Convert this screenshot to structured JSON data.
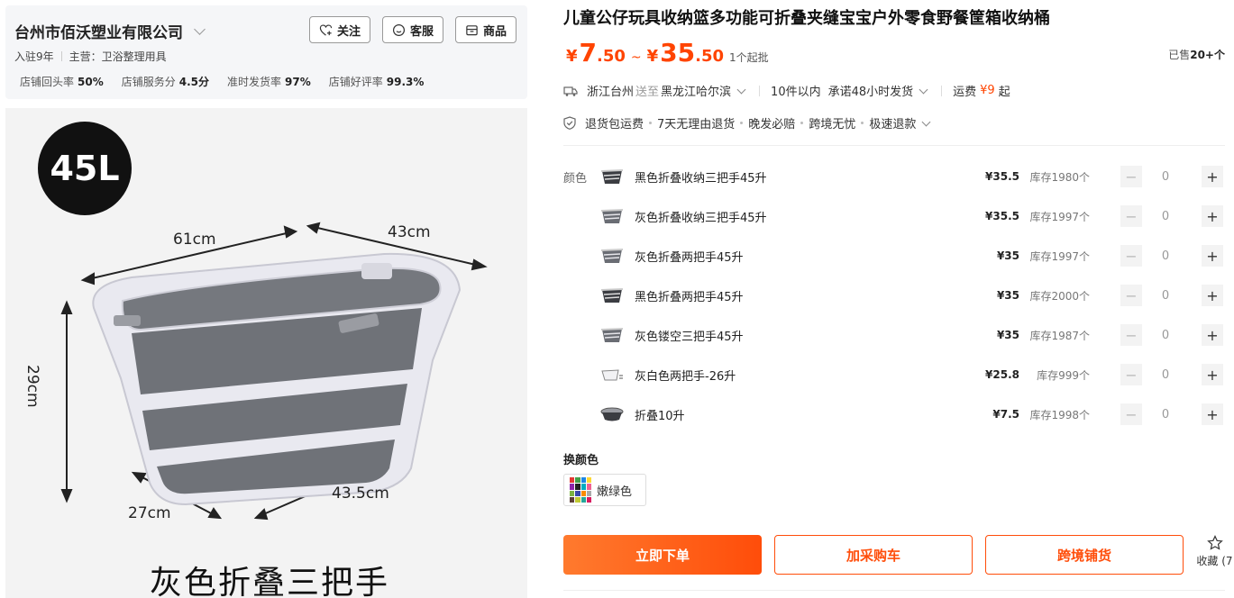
{
  "shop": {
    "name": "台州市佰沃塑业有限公司",
    "years": "入驻9年",
    "main_business": "主营：卫浴整理用具",
    "stats": [
      {
        "label": "店铺回头率",
        "value": "50%"
      },
      {
        "label": "店铺服务分",
        "value": "4.5分"
      },
      {
        "label": "准时发货率",
        "value": "97%"
      },
      {
        "label": "店铺好评率",
        "value": "99.3%"
      }
    ],
    "buttons": {
      "follow": "关注",
      "service": "客服",
      "goods": "商品"
    }
  },
  "image": {
    "badge": "45L",
    "dim_top_left": "61cm",
    "dim_top_right": "43cm",
    "dim_height": "29cm",
    "dim_bottom_left": "27cm",
    "dim_bottom_right": "43.5cm",
    "caption": "灰色折叠三把手"
  },
  "product": {
    "title": "儿童公仔玩具收纳篮多功能可折叠夹缝宝宝户外零食野餐筐箱收纳桶",
    "price_low_int": "7",
    "price_low_dec": ".50",
    "price_high_int": "35",
    "price_high_dec": ".50",
    "currency": "¥",
    "moq": "1个起批",
    "sold_prefix": "已售",
    "sold_value": "20+个"
  },
  "shipping": {
    "from": "浙江台州",
    "to_word": "送至",
    "to": "黑龙江哈尔滨",
    "qty_rule": "10件以内",
    "promise": "承诺48小时发货",
    "fee_label": "运费",
    "fee_value": "¥9",
    "fee_suffix": "起"
  },
  "services": [
    "退货包运费",
    "7天无理由退货",
    "晚发必赔",
    "跨境无忧",
    "极速退款"
  ],
  "sku": {
    "label": "颜色",
    "items": [
      {
        "name": "黑色折叠收纳三把手45升",
        "price": "¥35.5",
        "stock": "库存1980个",
        "qty": "0"
      },
      {
        "name": "灰色折叠收纳三把手45升",
        "price": "¥35.5",
        "stock": "库存1997个",
        "qty": "0"
      },
      {
        "name": "灰色折叠两把手45升",
        "price": "¥35",
        "stock": "库存1997个",
        "qty": "0"
      },
      {
        "name": "黑色折叠两把手45升",
        "price": "¥35",
        "stock": "库存2000个",
        "qty": "0"
      },
      {
        "name": "灰色镂空三把手45升",
        "price": "¥35",
        "stock": "库存1987个",
        "qty": "0"
      },
      {
        "name": "灰白色两把手-26升",
        "price": "¥25.8",
        "stock": "库存999个",
        "qty": "0"
      },
      {
        "name": "折叠10升",
        "price": "¥7.5",
        "stock": "库存1998个",
        "qty": "0"
      }
    ],
    "minus": "−",
    "plus": "+"
  },
  "swap": {
    "label": "换颜色",
    "option": "嫩绿色"
  },
  "actions": {
    "buy": "立即下单",
    "cart": "加采购车",
    "cross": "跨境铺货",
    "favorite": "收藏 (7"
  },
  "colors": {
    "accent": "#ff4400",
    "button_start": "#ff7a2e",
    "button_end": "#ff4d0a"
  }
}
